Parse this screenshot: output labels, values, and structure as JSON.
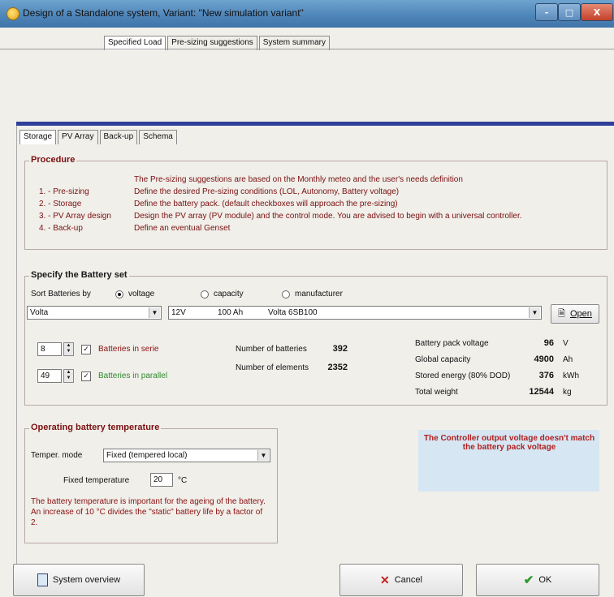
{
  "window": {
    "title": "Design of a Standalone system, Variant: \"New simulation variant\"",
    "minimize_glyph": "-",
    "maximize_glyph": "□",
    "close_glyph": "X"
  },
  "main_tabs": [
    "Specified Load",
    "Pre-sizing suggestions",
    "System summary"
  ],
  "sub_tabs": [
    "Storage",
    "PV Array",
    "Back-up",
    "Schema"
  ],
  "procedure": {
    "title": "Procedure",
    "intro": "The Pre-sizing suggestions are based on the Monthly meteo and the user's needs definition",
    "steps": [
      {
        "name": "1. - Pre-sizing",
        "desc": "Define the desired Pre-sizing conditions (LOL, Autonomy, Battery voltage)"
      },
      {
        "name": "2. - Storage",
        "desc": "Define the battery pack. (default checkboxes will approach the pre-sizing)"
      },
      {
        "name": "3. - PV Array design",
        "desc": "Design the PV array (PV module) and the control mode. You are advised to begin with a universal controller."
      },
      {
        "name": "4. - Back-up",
        "desc": "Define an eventual Genset"
      }
    ]
  },
  "battery_set": {
    "title": "Specify the Battery set",
    "sort_label": "Sort Batteries by",
    "sort_options": [
      "voltage",
      "capacity",
      "manufacturer"
    ],
    "sort_selected": "voltage",
    "manufacturer": "Volta",
    "battery_voltage": "12V",
    "battery_capacity": "100 Ah",
    "battery_model": "Volta 6SB100",
    "open_label": "Open",
    "series_count": "8",
    "series_label": "Batteries in serie",
    "parallel_count": "49",
    "parallel_label": "Batteries in parallel",
    "num_batteries_label": "Number of batteries",
    "num_batteries": "392",
    "num_elements_label": "Number of elements",
    "num_elements": "2352",
    "stats": [
      {
        "label": "Battery pack voltage",
        "value": "96",
        "unit": "V"
      },
      {
        "label": "Global capacity",
        "value": "4900",
        "unit": "Ah"
      },
      {
        "label": "Stored energy (80% DOD)",
        "value": "376",
        "unit": "kWh"
      },
      {
        "label": "Total weight",
        "value": "12544",
        "unit": "kg"
      }
    ]
  },
  "temperature": {
    "title": "Operating battery temperature",
    "mode_label": "Temper. mode",
    "mode_value": "Fixed (tempered local)",
    "fixed_label": "Fixed temperature",
    "fixed_value": "20",
    "fixed_unit": "°C",
    "note": "The battery temperature is important for the ageing of the battery. An increase of 10 °C divides the \"static\" battery life by a factor of 2."
  },
  "warning": "The Controller output voltage doesn't match the battery pack voltage",
  "footer": {
    "overview_label": "System overview",
    "cancel_label": "Cancel",
    "ok_label": "OK"
  },
  "colors": {
    "title_bar": "#4d84b8",
    "accent_bar": "#2f3f9a",
    "procedure_text": "#7a1010",
    "warning_text": "#b02020",
    "warning_bg": "#d6e6f2",
    "parallel_text": "#2e8a2e"
  }
}
